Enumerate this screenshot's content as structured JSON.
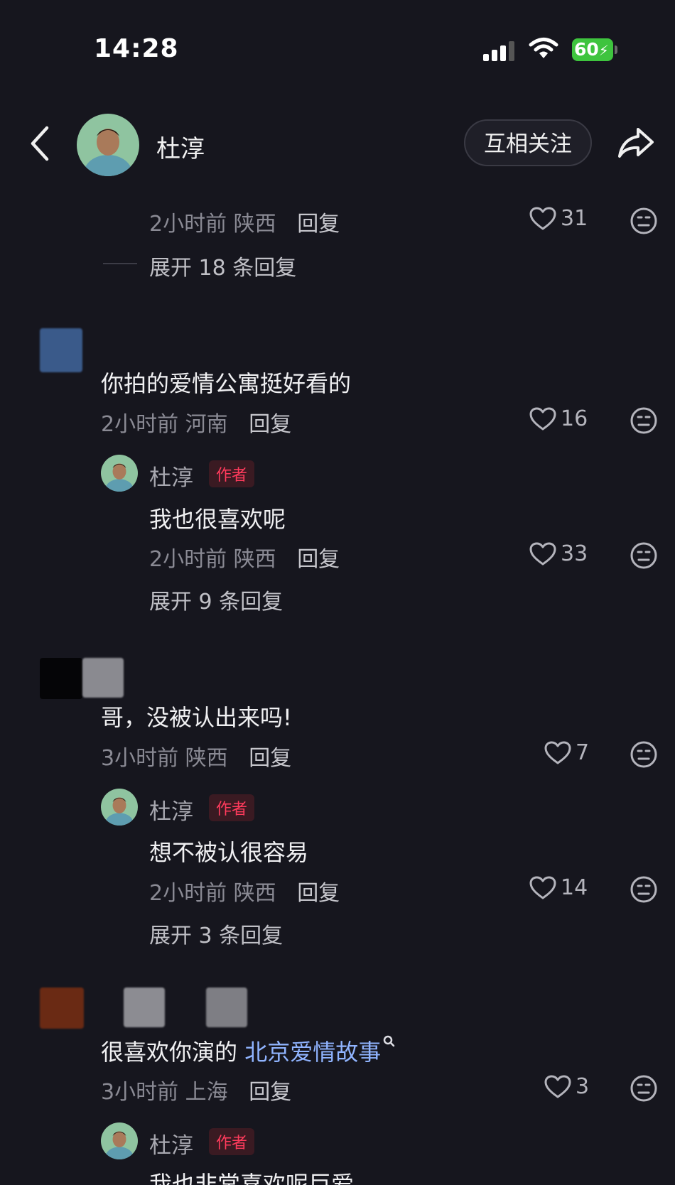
{
  "status": {
    "time": "14:28",
    "battery": "60"
  },
  "header": {
    "name": "杜淳",
    "follow_label": "互相关注"
  },
  "top": {
    "meta_time": "2小时前",
    "meta_loc": "陕西",
    "reply_label": "回复",
    "likes": "31",
    "expand_label": "展开 18 条回复"
  },
  "c1": {
    "text": "你拍的爱情公寓挺好看的",
    "meta_time": "2小时前",
    "meta_loc": "河南",
    "reply_label": "回复",
    "likes": "16",
    "reply": {
      "name": "杜淳",
      "badge": "作者",
      "text": "我也很喜欢呢",
      "meta_time": "2小时前",
      "meta_loc": "陕西",
      "reply_label": "回复",
      "likes": "33"
    },
    "expand_label": "展开 9 条回复"
  },
  "c2": {
    "text": "哥，没被认出来吗!",
    "meta_time": "3小时前",
    "meta_loc": "陕西",
    "reply_label": "回复",
    "likes": "7",
    "reply": {
      "name": "杜淳",
      "badge": "作者",
      "text": "想不被认很容易",
      "meta_time": "2小时前",
      "meta_loc": "陕西",
      "reply_label": "回复",
      "likes": "14"
    },
    "expand_label": "展开 3 条回复"
  },
  "c3": {
    "text_prefix": "很喜欢你演的 ",
    "text_link": "北京爱情故事",
    "meta_time": "3小时前",
    "meta_loc": "上海",
    "reply_label": "回复",
    "likes": "3",
    "reply": {
      "name": "杜淳",
      "badge": "作者",
      "text": "我也非常喜欢呢巨爱"
    }
  },
  "colors": {
    "background": "#16161e",
    "badge_red": "#ff3b5c",
    "battery_green": "#3ec43e",
    "link_blue": "#90b4ff"
  },
  "icons": [
    "back-chevron-icon",
    "share-arrow-icon",
    "heart-icon",
    "dislike-face-icon",
    "search-hint-icon",
    "signal-icon",
    "wifi-icon",
    "battery-icon"
  ]
}
